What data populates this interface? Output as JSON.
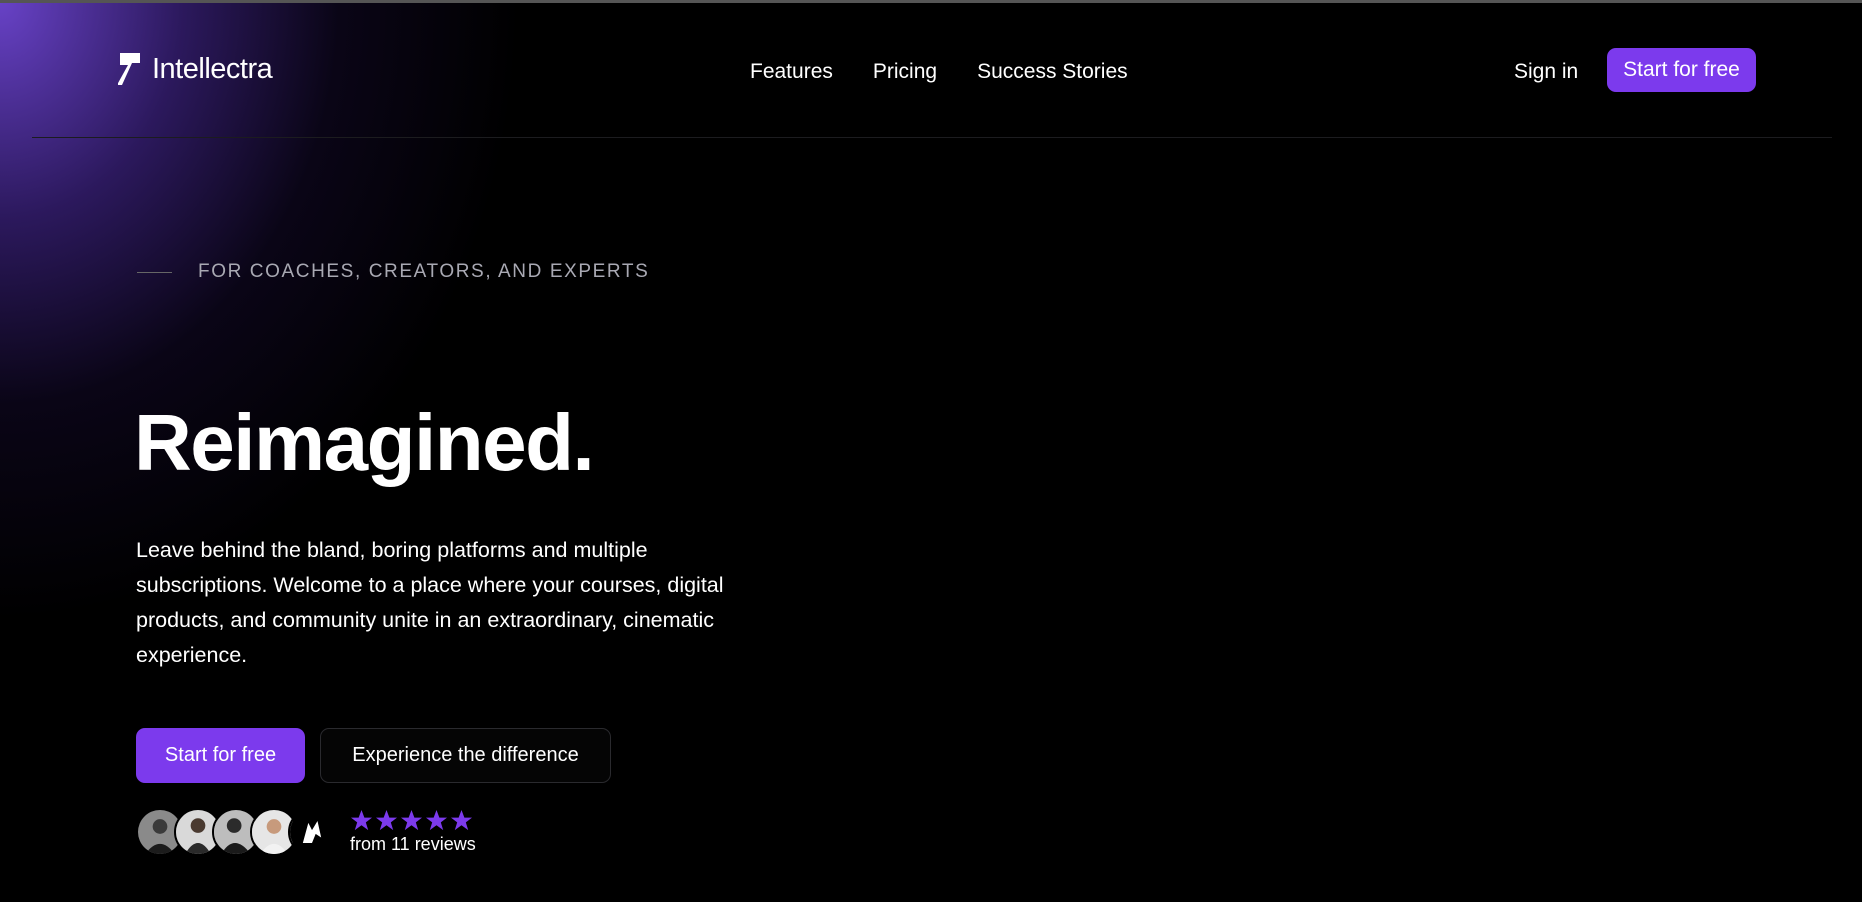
{
  "brand": {
    "name": "Intellectra"
  },
  "nav": {
    "items": [
      {
        "label": "Features"
      },
      {
        "label": "Pricing"
      },
      {
        "label": "Success Stories"
      }
    ],
    "signin_label": "Sign in",
    "cta_label": "Start for free"
  },
  "hero": {
    "eyebrow": "FOR COACHES, CREATORS, AND EXPERTS",
    "headline": "Reimagined.",
    "subtext": "Leave behind the bland, boring platforms and multiple subscriptions. Welcome to a place where your courses, digital products, and community unite in an extraordinary, cinematic experience.",
    "primary_cta": "Start for free",
    "secondary_cta": "Experience the difference"
  },
  "reviews": {
    "rating": 5,
    "max_rating": 5,
    "label": "from 11 reviews"
  },
  "colors": {
    "accent": "#7c3aed",
    "background": "#000000",
    "glow": "#6e46d2",
    "muted_text": "#a9a9b3"
  }
}
